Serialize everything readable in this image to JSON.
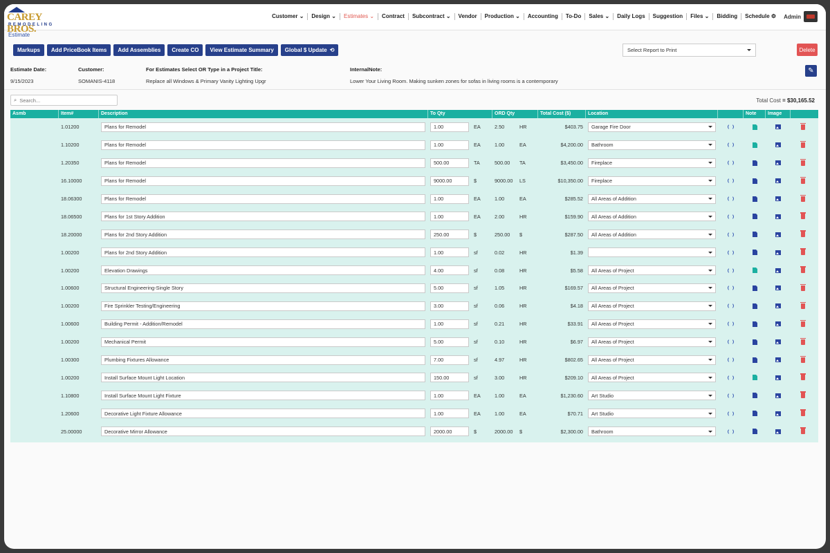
{
  "brand": {
    "name": "CAREY BROS.",
    "sub": "REMODELING"
  },
  "nav": [
    "Customer ⌄",
    "Design ⌄",
    "Estimates ⌄",
    "Contract",
    "Subcontract ⌄",
    "Vendor",
    "Production ⌄",
    "Accounting",
    "To-Do",
    "Sales ⌄",
    "Daily Logs",
    "Suggestion",
    "Files ⌄",
    "Bidding",
    "Schedule ⚙"
  ],
  "admin_label": "Admin",
  "breadcrumb": "Estimate",
  "toolbar": {
    "markups": "Markups",
    "add_pricebook": "Add PriceBook Items",
    "add_assemblies": "Add Assemblies",
    "create_co": "Create CO",
    "view_summary": "View Estimate Summary",
    "global_update": "Global $ Update"
  },
  "report_select": "Select Report to Print",
  "delete_label": "Delete",
  "info": {
    "date_label": "Estimate Date:",
    "date_value": "9/15/2023",
    "customer_label": "Customer:",
    "customer_value": "SOMANIS-4118",
    "title_label": "For Estimates Select OR Type in a Project Title:",
    "title_value": "Replace all Windows & Primary Vanity Lighting Upgr",
    "note_label": "InternalNote:",
    "note_value": "Lower Your Living Room. Making sunken zones for sofas in living rooms is a contemporary"
  },
  "search_placeholder": "Search...",
  "total_label": "Total Cost",
  "total_value": "= $30,165.52",
  "columns": [
    "Asmb",
    "Item#",
    "Description",
    "To Qty",
    "ORD Qty",
    "Total Cost ($)",
    "Location",
    "",
    "Note",
    "Image",
    ""
  ],
  "rows": [
    {
      "item": "1.01200",
      "desc": "Plans for Remodel",
      "qty": "1.00",
      "unit": "EA",
      "ord": "2.50",
      "ord_unit": "HR",
      "cost": "$403.75",
      "loc": "Garage Fire Door",
      "note": "green"
    },
    {
      "item": "1.10200",
      "desc": "Plans for Remodel",
      "qty": "1.00",
      "unit": "EA",
      "ord": "1.00",
      "ord_unit": "EA",
      "cost": "$4,200.00",
      "loc": "Bathroom",
      "note": "green"
    },
    {
      "item": "1.20350",
      "desc": "Plans for Remodel",
      "qty": "500.00",
      "unit": "TA",
      "ord": "500.00",
      "ord_unit": "TA",
      "cost": "$3,450.00",
      "loc": "Fireplace",
      "note": "blue"
    },
    {
      "item": "16.10000",
      "desc": "Plans for Remodel",
      "qty": "9000.00",
      "unit": "$",
      "ord": "9000.00",
      "ord_unit": "LS",
      "cost": "$10,350.00",
      "loc": "Fireplace",
      "note": "blue"
    },
    {
      "item": "18.06300",
      "desc": "Plans for Remodel",
      "qty": "1.00",
      "unit": "EA",
      "ord": "1.00",
      "ord_unit": "EA",
      "cost": "$285.52",
      "loc": "All Areas of Addition",
      "note": "blue"
    },
    {
      "item": "18.06500",
      "desc": "Plans for 1st Story Addition",
      "qty": "1.00",
      "unit": "EA",
      "ord": "2.00",
      "ord_unit": "HR",
      "cost": "$159.90",
      "loc": "All Areas of Addition",
      "note": "blue"
    },
    {
      "item": "18.20000",
      "desc": "Plans for 2nd Story Addition",
      "qty": "250.00",
      "unit": "$",
      "ord": "250.00",
      "ord_unit": "$",
      "cost": "$287.50",
      "loc": "All Areas of Addition",
      "note": "blue"
    },
    {
      "item": "1.00200",
      "desc": "Plans for 2nd Story Addition",
      "qty": "1.00",
      "unit": "sf",
      "ord": "0.02",
      "ord_unit": "HR",
      "cost": "$1.39",
      "loc": "",
      "note": "blue"
    },
    {
      "item": "1.00200",
      "desc": "Elevation Drawings",
      "qty": "4.00",
      "unit": "sf",
      "ord": "0.08",
      "ord_unit": "HR",
      "cost": "$5.58",
      "loc": "All Areas of Project",
      "note": "green"
    },
    {
      "item": "1.00600",
      "desc": "Structural Engineering-Single Story",
      "qty": "5.00",
      "unit": "sf",
      "ord": "1.05",
      "ord_unit": "HR",
      "cost": "$169.57",
      "loc": "All Areas of Project",
      "note": "blue"
    },
    {
      "item": "1.00200",
      "desc": "Fire Sprinkler Testing/Engineering",
      "qty": "3.00",
      "unit": "sf",
      "ord": "0.06",
      "ord_unit": "HR",
      "cost": "$4.18",
      "loc": "All Areas of Project",
      "note": "blue"
    },
    {
      "item": "1.00600",
      "desc": "Building Permit - Addition/Remodel",
      "qty": "1.00",
      "unit": "sf",
      "ord": "0.21",
      "ord_unit": "HR",
      "cost": "$33.91",
      "loc": "All Areas of Project",
      "note": "blue"
    },
    {
      "item": "1.00200",
      "desc": "Mechanical Permit",
      "qty": "5.00",
      "unit": "sf",
      "ord": "0.10",
      "ord_unit": "HR",
      "cost": "$6.97",
      "loc": "All Areas of Project",
      "note": "blue"
    },
    {
      "item": "1.00300",
      "desc": "Plumbing Fixtures Allowance",
      "qty": "7.00",
      "unit": "sf",
      "ord": "4.97",
      "ord_unit": "HR",
      "cost": "$802.65",
      "loc": "All Areas of Project",
      "note": "blue"
    },
    {
      "item": "1.00200",
      "desc": "Install Surface Mount Light Location",
      "qty": "150.00",
      "unit": "sf",
      "ord": "3.00",
      "ord_unit": "HR",
      "cost": "$209.10",
      "loc": "All Areas of Project",
      "note": "green"
    },
    {
      "item": "1.10800",
      "desc": "Install Surface Mount Light Fixture",
      "qty": "1.00",
      "unit": "EA",
      "ord": "1.00",
      "ord_unit": "EA",
      "cost": "$1,230.60",
      "loc": "Art Studio",
      "note": "blue"
    },
    {
      "item": "1.20600",
      "desc": "Decorative Light Fixture Allowance",
      "qty": "1.00",
      "unit": "EA",
      "ord": "1.00",
      "ord_unit": "EA",
      "cost": "$70.71",
      "loc": "Art Studio",
      "note": "blue"
    },
    {
      "item": "25.00000",
      "desc": "Decorative Mirror Allowance",
      "qty": "2000.00",
      "unit": "$",
      "ord": "2000.00",
      "ord_unit": "$",
      "cost": "$2,300.00",
      "loc": "Bathroom",
      "note": "blue"
    }
  ]
}
